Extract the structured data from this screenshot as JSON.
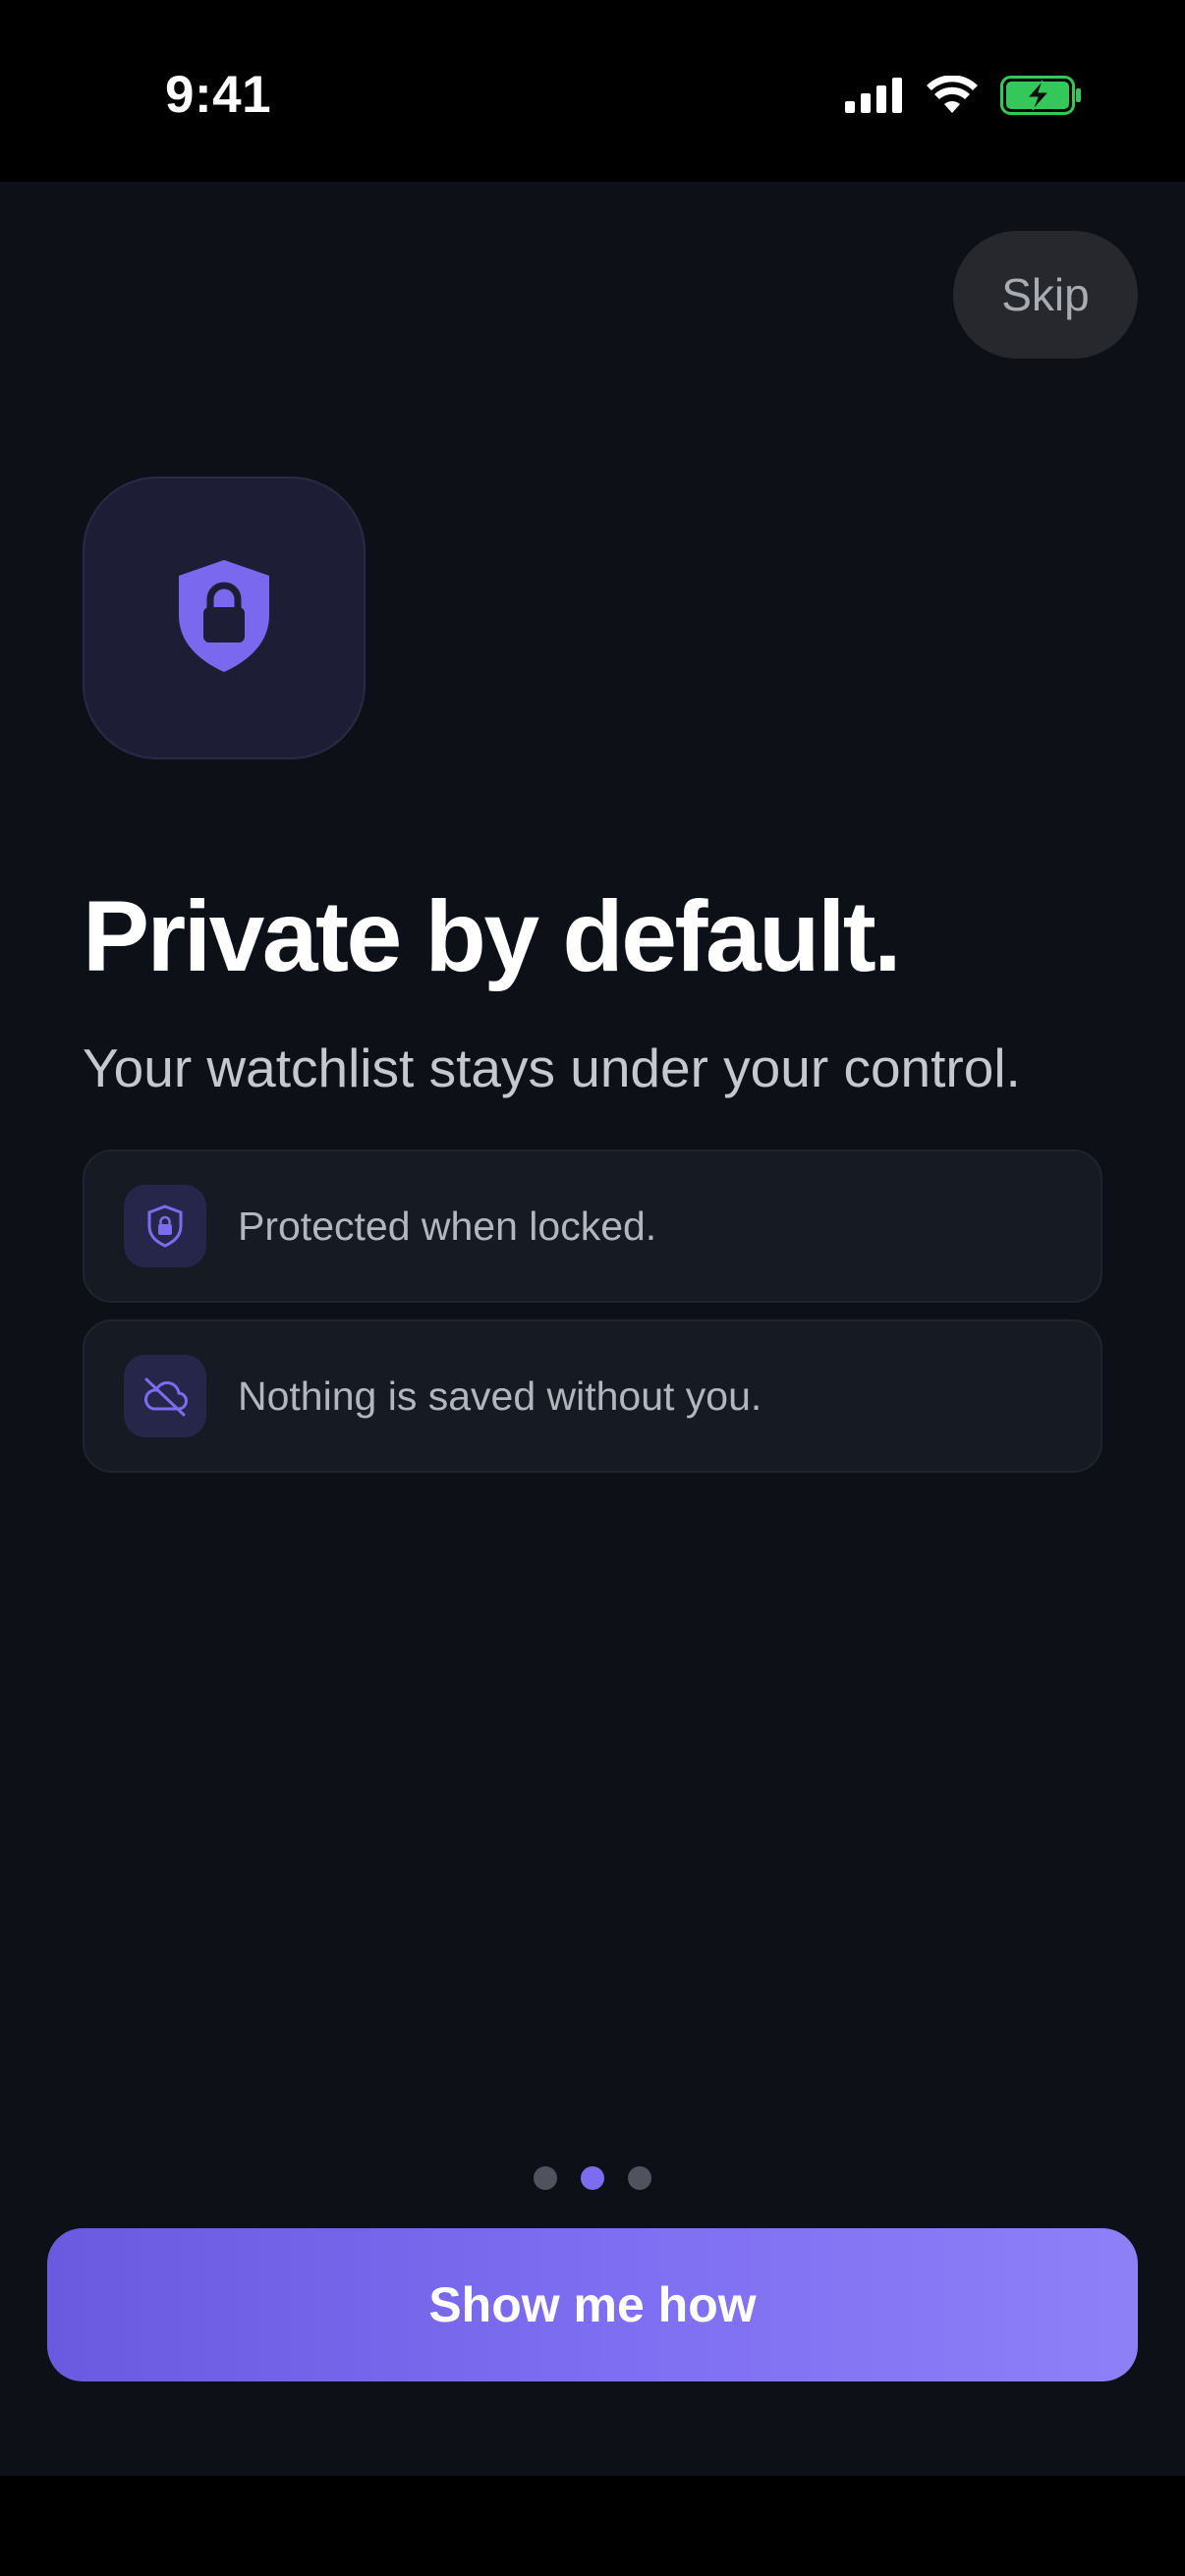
{
  "status_bar": {
    "time": "9:41"
  },
  "skip_label": "Skip",
  "title": "Private by default.",
  "subtitle": "Your watchlist stays under your control.",
  "features": [
    {
      "icon": "shield-lock-icon",
      "text": "Protected when locked."
    },
    {
      "icon": "cloud-off-icon",
      "text": "Nothing is saved without you."
    }
  ],
  "pagination": {
    "total": 3,
    "active": 2
  },
  "cta_label": "Show me how",
  "colors": {
    "background": "#0e1018",
    "accent": "#7b6cf0",
    "card": "#161a23",
    "battery_green": "#34c759"
  }
}
